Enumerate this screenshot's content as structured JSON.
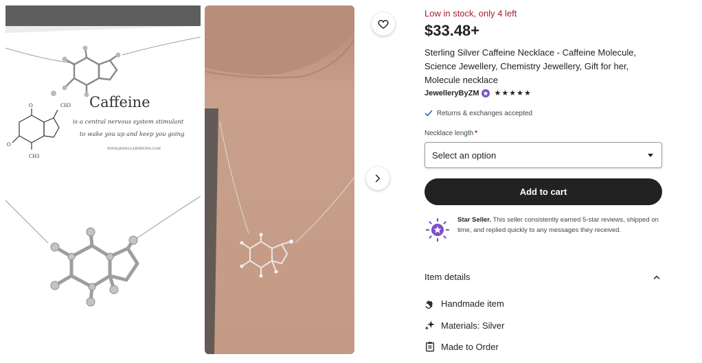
{
  "gallery": {
    "card_word": "Caffeine",
    "card_line_1": "is a central nervous system stimulant",
    "card_line_2": "to wake you up and keep you going",
    "card_url": "WWW.JEWELLERYBYZM.COM"
  },
  "stock_status": "Low in stock, only 4 left",
  "price": "$33.48+",
  "title": "Sterling Silver Caffeine Necklace - Caffeine Molecule, Science Jewellery, Chemistry Jewellery, Gift for her, Molecule necklace",
  "seller": {
    "name": "JewelleryByZM",
    "rating": 5
  },
  "returns_text": "Returns & exchanges accepted",
  "option": {
    "label": "Necklace length",
    "required_mark": "*",
    "placeholder": "Select an option"
  },
  "add_to_cart": "Add to cart",
  "star_seller": {
    "title": "Star Seller.",
    "text": "This seller consistently earned 5-star reviews, shipped on time, and replied quickly to any messages they received."
  },
  "item_details": {
    "heading": "Item details",
    "items": [
      {
        "icon": "hand-icon",
        "label": "Handmade item"
      },
      {
        "icon": "sparkle-icon",
        "label": "Materials: Silver"
      },
      {
        "icon": "clipboard-icon",
        "label": "Made to Order"
      }
    ]
  },
  "colors": {
    "stock_red": "#a61a2e",
    "button_dark": "#222222",
    "star_seller_purple": "#7f50c5"
  }
}
